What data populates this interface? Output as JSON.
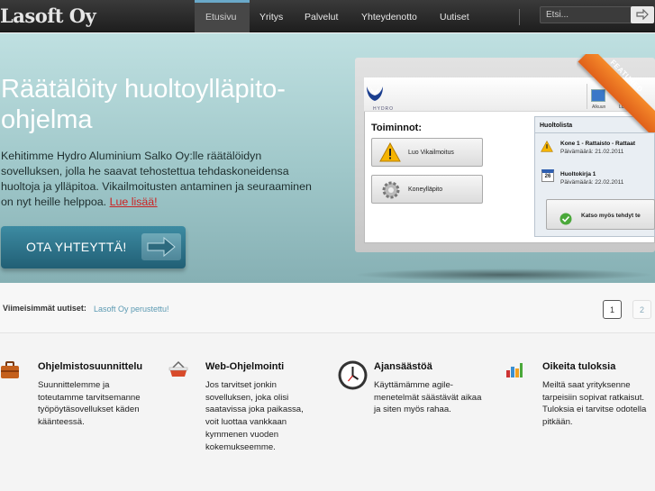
{
  "brand": "Lasoft Oy",
  "nav": {
    "items": [
      {
        "label": "Etusivu"
      },
      {
        "label": "Yritys"
      },
      {
        "label": "Palvelut"
      },
      {
        "label": "Yhteydenotto"
      },
      {
        "label": "Uutiset"
      }
    ],
    "active_index": 0,
    "search_placeholder": "Etsi..."
  },
  "hero": {
    "title": "Räätälöity huoltoylläpito-ohjelma",
    "text": "Kehitimme Hydro Aluminium Salko Oy:lle räätälöidyn sovelluksen, jolla he saavat tehostettua tehdaskoneidensa huoltoja ja ylläpitoa. Vikailmoitusten antaminen ja seuraaminen on nyt heille helppoa.",
    "link": "Lue lisää!",
    "cta": "OTA YHTEYTTÄ!"
  },
  "screenshot": {
    "brand": "HYDRO",
    "ribbon": "FEATURED",
    "header_labels": [
      "Alkuun",
      "Luo Vikailm"
    ],
    "actions_title": "Toiminnot:",
    "actions": [
      "Luo Vikailmoitus",
      "Koneylläpito"
    ],
    "panel_title": "Huoltolista",
    "entries": [
      {
        "title": "Kone 1 - Rattaisto - Rattaat",
        "date": "Päivämäärä: 21.02.2011"
      },
      {
        "title": "Huoltokirja 1",
        "date": "Päivämäärä: 22.02.2011"
      }
    ],
    "calendar_day": "26",
    "panel_button": "Katso myös tehdyt te"
  },
  "news": {
    "label": "Viimeisimmät uutiset:",
    "item": "Lasoft Oy perustettu!",
    "pages": [
      "1",
      "2"
    ]
  },
  "features": [
    {
      "icon": "briefcase-icon",
      "title": "Ohjelmistosuunnittelu",
      "text": [
        "Suunnittelemme ja",
        "toteutamme tarvitsemanne",
        "työpöytäsovellukset käden",
        "käänteessä."
      ]
    },
    {
      "icon": "basket-icon",
      "title": "Web-Ohjelmointi",
      "text": [
        "Jos tarvitset jonkin",
        "sovelluksen, joka olisi",
        "saatavissa joka paikassa,",
        "voit luottaa vankkaan",
        "kymmenen vuoden",
        "kokemukseemme."
      ]
    },
    {
      "icon": "clock-icon",
      "title": "Ajansäästöä",
      "text": [
        "Käyttämämme agile-",
        "menetelmät säästävät aikaa",
        "ja siten myös rahaa."
      ]
    },
    {
      "icon": "chart-icon",
      "title": "Oikeita tuloksia",
      "text": [
        "Meiltä saat yrityksenne",
        "tarpeisiin sopivat ratkaisut.",
        "Tuloksia ei tarvitse odotella",
        "pitkään."
      ]
    }
  ]
}
